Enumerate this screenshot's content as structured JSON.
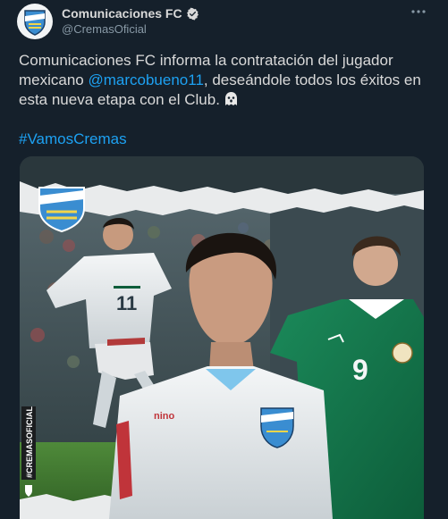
{
  "author": {
    "display_name": "Comunicaciones FC",
    "handle": "@CremasOficial",
    "avatar_icon": "comunicaciones-crest-icon",
    "verified_icon": "verified-badge-icon"
  },
  "tweet": {
    "text_before": "Comunicaciones FC informa la contratación del jugador mexicano ",
    "mention": "@marcobueno11",
    "text_after": ", deseándole todos los éxitos en esta nueva etapa con el Club.",
    "emoji_icon": "ghost-icon",
    "hashtag": "#VamosCremas"
  },
  "media": {
    "crest_label": "COMUNICACIONES",
    "side_tag": "#CREMASOFICIAL",
    "left_jersey_number": "11",
    "right_jersey_number": "9",
    "center_shirt_brand": "nino"
  },
  "colors": {
    "background": "#15202b",
    "text": "#d9d9d9",
    "secondary": "#8899a6",
    "link": "#1da1f2"
  }
}
